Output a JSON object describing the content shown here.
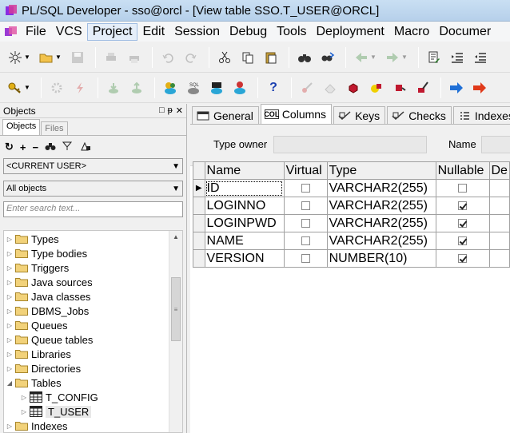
{
  "window": {
    "title": "PL/SQL Developer - sso@orcl - [View table SSO.T_USER@ORCL]"
  },
  "menu": [
    "File",
    "VCS",
    "Project",
    "Edit",
    "Session",
    "Debug",
    "Tools",
    "Deployment",
    "Macro",
    "Documer"
  ],
  "objects_panel": {
    "header": "Objects",
    "tabs": [
      "Objects",
      "Files"
    ],
    "user_filter": "<CURRENT USER>",
    "object_filter": "All objects",
    "search_placeholder": "Enter search text...",
    "tree": [
      {
        "label": "Types",
        "expanded": false
      },
      {
        "label": "Type bodies",
        "expanded": false
      },
      {
        "label": "Triggers",
        "expanded": false
      },
      {
        "label": "Java sources",
        "expanded": false
      },
      {
        "label": "Java classes",
        "expanded": false
      },
      {
        "label": "DBMS_Jobs",
        "expanded": false
      },
      {
        "label": "Queues",
        "expanded": false
      },
      {
        "label": "Queue tables",
        "expanded": false
      },
      {
        "label": "Libraries",
        "expanded": false
      },
      {
        "label": "Directories",
        "expanded": false
      },
      {
        "label": "Tables",
        "expanded": true
      },
      {
        "label": "T_CONFIG",
        "child": true
      },
      {
        "label": "T_USER",
        "child": true,
        "selected": true
      },
      {
        "label": "Indexes",
        "expanded": false
      }
    ]
  },
  "editor": {
    "tabs": [
      "General",
      "Columns",
      "Keys",
      "Checks",
      "Indexes"
    ],
    "active_tab": "Columns",
    "type_owner_label": "Type owner",
    "name_label": "Name",
    "columns_header": [
      "Name",
      "Virtual",
      "Type",
      "Nullable",
      "De"
    ],
    "rows": [
      {
        "name": "ID",
        "virtual": false,
        "type": "VARCHAR2(255)",
        "nullable": false
      },
      {
        "name": "LOGINNO",
        "virtual": false,
        "type": "VARCHAR2(255)",
        "nullable": true
      },
      {
        "name": "LOGINPWD",
        "virtual": false,
        "type": "VARCHAR2(255)",
        "nullable": true
      },
      {
        "name": "NAME",
        "virtual": false,
        "type": "VARCHAR2(255)",
        "nullable": true
      },
      {
        "name": "VERSION",
        "virtual": false,
        "type": "NUMBER(10)",
        "nullable": true
      }
    ]
  }
}
